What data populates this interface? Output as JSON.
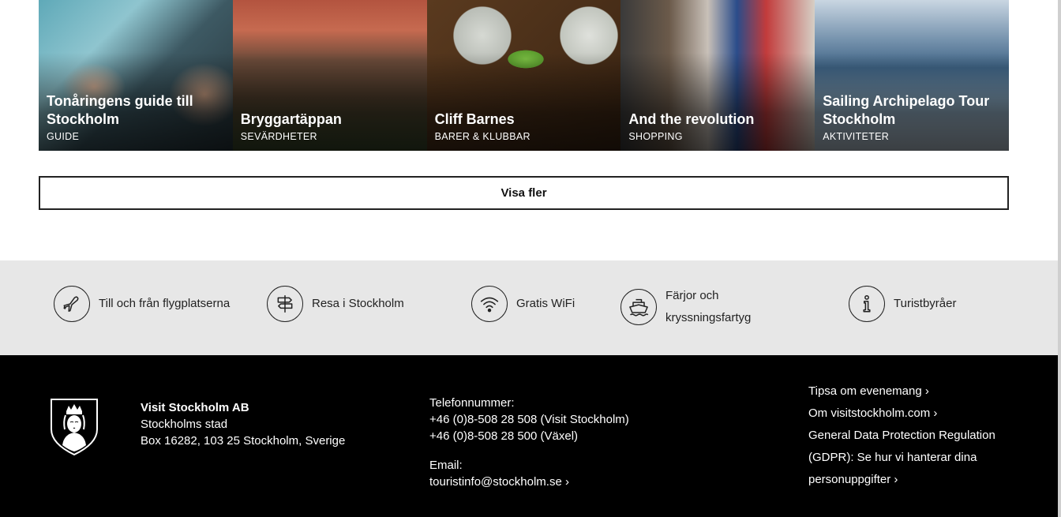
{
  "cards": [
    {
      "title": "Tonåringens guide till Stockholm",
      "category": "GUIDE"
    },
    {
      "title": "Bryggartäppan",
      "category": "SEVÄRDHETER"
    },
    {
      "title": "Cliff Barnes",
      "category": "BARER & KLUBBAR"
    },
    {
      "title": "And the revolution",
      "category": "SHOPPING"
    },
    {
      "title": "Sailing Archipelago Tour Stockholm",
      "category": "AKTIVITETER"
    }
  ],
  "more_button": "Visa fler",
  "services": [
    {
      "label": "Till och från flygplatserna",
      "icon": "airplane-icon"
    },
    {
      "label": "Resa i Stockholm",
      "icon": "signpost-icon"
    },
    {
      "label": "Gratis WiFi",
      "icon": "wifi-icon"
    },
    {
      "label": "Färjor och kryssningsfartyg",
      "icon": "ship-icon"
    },
    {
      "label": "Turistbyråer",
      "icon": "info-icon"
    }
  ],
  "footer": {
    "org_name": "Visit Stockholm AB",
    "org_line1": "Stockholms stad",
    "org_line2": "Box 16282, 103 25 Stockholm, Sverige",
    "phone_label": "Telefonnummer:",
    "phone1": "+46 (0)8-508 28 508 (Visit Stockholm)",
    "phone2": "+46 (0)8-508 28 500 (Växel)",
    "email_label": "Email:",
    "email": "touristinfo@stockholm.se ›",
    "links": [
      "Tipsa om evenemang ›",
      "Om visitstockholm.com ›",
      "General Data Protection Regulation (GDPR): Se hur vi hanterar dina personuppgifter ›"
    ]
  }
}
